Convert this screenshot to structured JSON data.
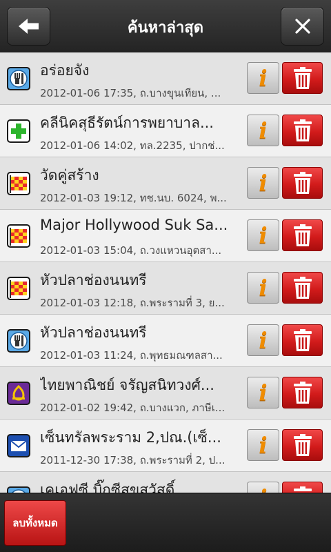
{
  "header": {
    "title": "ค้นหาล่าสุด",
    "back_icon": "arrow-left-icon",
    "close_icon": "close-icon"
  },
  "colors": {
    "delete_red": "#d21b1b",
    "info_orange": "#f08c00",
    "header_bg": "#2e2e2e"
  },
  "items": [
    {
      "name": "อร่อยจัง",
      "detail": "2012-01-06 17:35, ถ.บางขุนเทียน, ...",
      "icon": "restaurant-icon"
    },
    {
      "name": "คลีนิคสุธีรัตน์การพยาบาล...",
      "detail": "2012-01-06 14:02, ทล.2235, ปากช่...",
      "icon": "hospital-icon"
    },
    {
      "name": "วัดคู่สร้าง",
      "detail": "2012-01-03 19:12, ทช.นบ. 6024, พ...",
      "icon": "checkered-flag-icon"
    },
    {
      "name": "Major Hollywood Suk Sa...",
      "detail": "2012-01-03 15:04, ถ.วงแหวนอุตสา...",
      "icon": "checkered-flag-icon"
    },
    {
      "name": "หัวปลาช่องนนทรี",
      "detail": "2012-01-03 12:18, ถ.พระรามที่ 3, ย...",
      "icon": "checkered-flag-icon"
    },
    {
      "name": "หัวปลาช่องนนทรี",
      "detail": "2012-01-03 11:24, ถ.พุทธมณฑลสา...",
      "icon": "restaurant-icon"
    },
    {
      "name": "ไทยพาณิชย์ จรัญสนิทวงศ์...",
      "detail": "2012-01-02 19:42, ถ.บางแวก, ภาษีเ...",
      "icon": "bank-icon"
    },
    {
      "name": "เซ็นทรัลพระราม 2,ปณ.(เซ็...",
      "detail": "2011-12-30 17:38, ถ.พระรามที่ 2, ป...",
      "icon": "post-office-icon"
    },
    {
      "name": "เคเอฟซี บิ๊กซีสุขสวัสดิ์",
      "detail": "",
      "icon": "restaurant-icon"
    }
  ],
  "footer": {
    "delete_all_label": "ลบทั้งหมด"
  }
}
